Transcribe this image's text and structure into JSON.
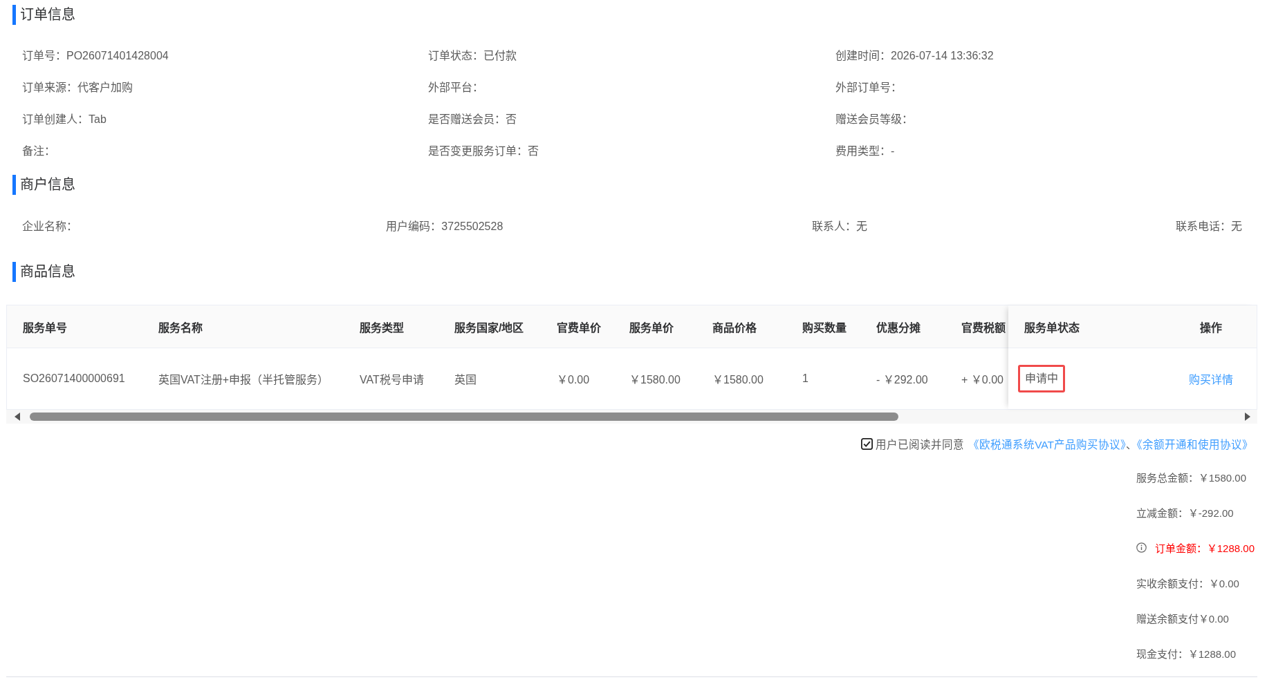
{
  "order_info": {
    "title": "订单信息",
    "fields": [
      "订单号：PO26071401428004",
      "订单状态：已付款",
      "创建时间：2026-07-14 13:36:32",
      "订单来源：代客户加购",
      "外部平台：",
      "外部订单号：",
      "订单创建人：Tab",
      "是否赠送会员：否",
      "赠送会员等级：",
      "备注：",
      "是否变更服务订单：否",
      "费用类型：-"
    ]
  },
  "merchant_info": {
    "title": "商户信息",
    "fields": [
      "企业名称：",
      "用户编码：3725502528",
      "联系人：无",
      "联系电话：无"
    ]
  },
  "goods_info": {
    "title": "商品信息",
    "table": {
      "columns": [
        "服务单号",
        "服务名称",
        "服务类型",
        "服务国家/地区",
        "官费单价",
        "服务单价",
        "商品价格",
        "购买数量",
        "优惠分摊",
        "官费税额",
        "服务单状态",
        "操作"
      ],
      "rows": [
        {
          "cells": [
            {
              "kind": "text",
              "text": "SO26071400000691"
            },
            {
              "kind": "text",
              "text": "英国VAT注册+申报（半托管服务）"
            },
            {
              "kind": "text",
              "text": "VAT税号申请"
            },
            {
              "kind": "text",
              "text": "英国"
            },
            {
              "kind": "text",
              "text": "￥0.00"
            },
            {
              "kind": "text",
              "text": "￥1580.00"
            },
            {
              "kind": "text",
              "text": "￥1580.00"
            },
            {
              "kind": "text",
              "text": "1"
            },
            {
              "kind": "text",
              "text": "- ￥292.00"
            },
            {
              "kind": "text",
              "text": "+ ￥0.00"
            },
            {
              "kind": "status",
              "text": "申请中"
            },
            {
              "kind": "link",
              "text": "购买详情"
            }
          ]
        }
      ]
    }
  },
  "agreement": {
    "checked": true,
    "parts": [
      {
        "kind": "text",
        "text": "用户已阅读并同意"
      },
      {
        "kind": "link",
        "text": "《欧税通系统VAT产品购买协议》"
      },
      {
        "kind": "text",
        "text": "、"
      },
      {
        "kind": "link",
        "text": "《余额开通和使用协议》"
      }
    ]
  },
  "summary": [
    {
      "kind": "normal",
      "text": "服务总金额：￥1580.00"
    },
    {
      "kind": "normal",
      "text": "立减金额：￥-292.00"
    },
    {
      "kind": "emphasis",
      "text": "订单金额：￥1288.00"
    },
    {
      "kind": "normal",
      "text": "实收余额支付：￥0.00"
    },
    {
      "kind": "normal",
      "text": "赠送余额支付￥0.00"
    },
    {
      "kind": "normal",
      "text": "现金支付：￥1288.00"
    }
  ]
}
